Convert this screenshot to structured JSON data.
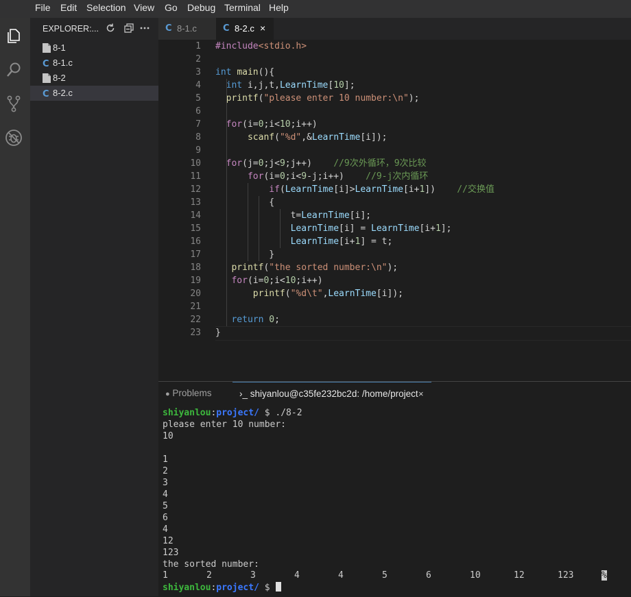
{
  "menu": [
    "File",
    "Edit",
    "Selection",
    "View",
    "Go",
    "Debug",
    "Terminal",
    "Help"
  ],
  "activity_icons": [
    "files-icon",
    "search-icon",
    "source-control-icon",
    "debug-icon"
  ],
  "explorer": {
    "title": "EXPLORER:...",
    "tools": [
      "refresh-icon",
      "collapse-all-icon",
      "more-icon"
    ],
    "files": [
      {
        "name": "8-1",
        "icon": "file-icon"
      },
      {
        "name": "8-1.c",
        "icon": "c-file-icon"
      },
      {
        "name": "8-2",
        "icon": "file-icon"
      },
      {
        "name": "8-2.c",
        "icon": "c-file-icon"
      }
    ]
  },
  "tabs": [
    {
      "label": "8-1.c",
      "active": false
    },
    {
      "label": "8-2.c",
      "active": true,
      "close": "×"
    }
  ],
  "editor": {
    "line_numbers": [
      "1",
      "2",
      "3",
      "4",
      "5",
      "6",
      "7",
      "8",
      "9",
      "10",
      "11",
      "12",
      "13",
      "14",
      "15",
      "16",
      "17",
      "18",
      "19",
      "20",
      "21",
      "22",
      "23"
    ],
    "code": [
      "#include<stdio.h>",
      "",
      "int main(){",
      "  int i,j,t,LearnTime[10];",
      "  printf(\"please enter 10 number:\\n\");",
      "",
      "  for(i=0;i<10;i++)",
      "      scanf(\"%d\",&LearnTime[i]);",
      "",
      "  for(j=0;j<9;j++)    //9次外循环，9次比较",
      "      for(i=0;i<9-j;i++)    //9-j次内循环",
      "          if(LearnTime[i]>LearnTime[i+1])    //交换值",
      "          {",
      "              t=LearnTime[i];",
      "              LearnTime[i] = LearnTime[i+1];",
      "              LearnTime[i+1] = t;",
      "          }",
      "   printf(\"the sorted number:\\n\");",
      "   for(i=0;i<10;i++)",
      "       printf(\"%d\\t\",LearnTime[i]);",
      "",
      "   return 0;",
      "}"
    ]
  },
  "panel": {
    "problems_label": "Problems",
    "terminal_label": "›_ shiyanlou@c35fe232bc2d: /home/project",
    "terminal_close": "×",
    "terminal": {
      "user": "shiyanlou",
      "colon": ":",
      "path": "project/",
      "prompt": " $ ",
      "command": "./8-2",
      "lines": [
        "please enter 10 number:",
        "10",
        "",
        "1",
        "2",
        "3",
        "4",
        "5",
        "6",
        "4",
        "12",
        "123",
        "the sorted number:"
      ],
      "sorted_output": [
        "1",
        "2",
        "3",
        "4",
        "4",
        "5",
        "6",
        "10",
        "12",
        "123"
      ],
      "trailing_char": "%"
    }
  }
}
